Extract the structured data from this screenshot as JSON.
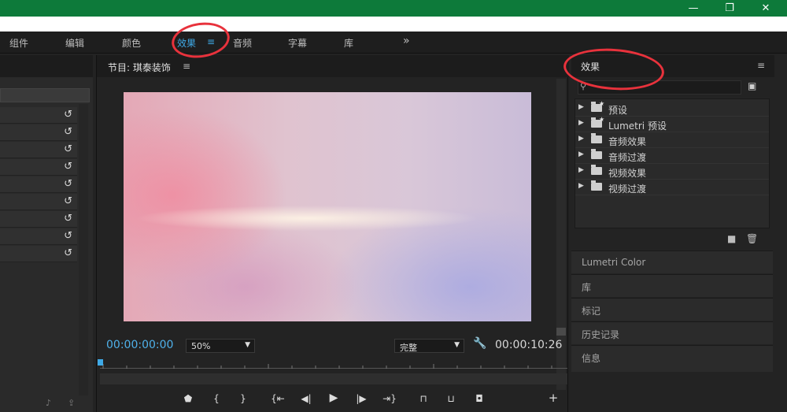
{
  "window_controls": {
    "minimize": "—",
    "restore": "❐",
    "close": "✕"
  },
  "workspaces": {
    "items": [
      "组件",
      "编辑",
      "颜色",
      "效果",
      "音频",
      "字幕",
      "库"
    ],
    "active": "效果",
    "menu_glyph": "≡",
    "overflow": "»"
  },
  "left_panel": {
    "reset_glyph": "↺",
    "row_count": 9
  },
  "program_monitor": {
    "title": "节目: 琪泰装饰",
    "menu_glyph": "≡",
    "timecode_current": "00:00:00:00",
    "zoom": "50%",
    "quality": "完整",
    "timecode_duration": "00:00:10:26",
    "transport_buttons": [
      "marker",
      "mark-in",
      "mark-out",
      "go-to-in",
      "step-back",
      "play",
      "step-forward",
      "go-to-out",
      "lift",
      "extract",
      "export-frame",
      "add"
    ]
  },
  "effects_panel": {
    "title": "效果",
    "menu_glyph": "≡",
    "tree": [
      {
        "label": "预设",
        "star": true
      },
      {
        "label": "Lumetri 预设",
        "star": true
      },
      {
        "label": "音频效果",
        "star": false
      },
      {
        "label": "音频过渡",
        "star": false
      },
      {
        "label": "视频效果",
        "star": false
      },
      {
        "label": "视频过渡",
        "star": false
      }
    ]
  },
  "collapsed_panels": [
    "Lumetri Color",
    "库",
    "标记",
    "历史记录",
    "信息"
  ],
  "colors": {
    "title_bar": "#0d7a3a",
    "accent": "#3fa9e6",
    "annotation": "#e8323c"
  }
}
